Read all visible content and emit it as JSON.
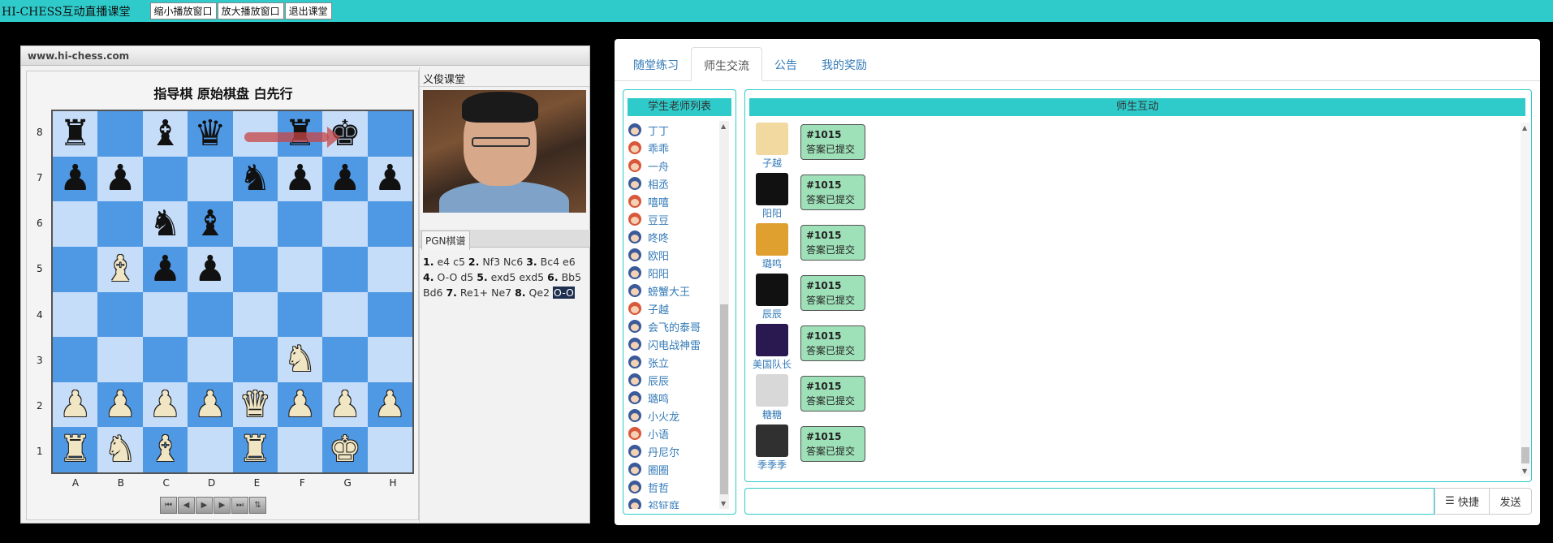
{
  "topbar": {
    "title": "HI-CHESS互动直播课堂",
    "buttons": [
      "缩小播放窗口",
      "放大播放窗口",
      "退出课堂"
    ]
  },
  "chess": {
    "site": "www.hi-chess.com",
    "title": "指导棋 原始棋盘 白先行",
    "ranks": [
      "8",
      "7",
      "6",
      "5",
      "4",
      "3",
      "2",
      "1"
    ],
    "files": [
      "A",
      "B",
      "C",
      "D",
      "E",
      "F",
      "G",
      "H"
    ],
    "board": [
      [
        "r",
        "",
        "b",
        "q",
        "",
        "r",
        "k",
        ""
      ],
      [
        "p",
        "p",
        "",
        "",
        "n",
        "p",
        "p",
        "p"
      ],
      [
        "",
        "",
        "n",
        "b",
        "",
        "",
        "",
        ""
      ],
      [
        "",
        "B",
        "p",
        "p",
        "",
        "",
        "",
        ""
      ],
      [
        "",
        "",
        "",
        "",
        "",
        "",
        "",
        ""
      ],
      [
        "",
        "",
        "",
        "",
        "",
        "N",
        "",
        ""
      ],
      [
        "P",
        "P",
        "P",
        "P",
        "Q",
        "P",
        "P",
        "P"
      ],
      [
        "R",
        "N",
        "B",
        "",
        "R",
        "",
        "K",
        ""
      ]
    ],
    "nav_icons": [
      "first-move-icon",
      "prev-move-icon",
      "play-icon",
      "next-move-icon",
      "last-move-icon",
      "flip-board-icon"
    ],
    "video_title": "义俊课堂",
    "pgn_tab": "PGN棋谱",
    "pgn": [
      {
        "n": "1.",
        "w": "e4",
        "b": "c5"
      },
      {
        "n": "2.",
        "w": "Nf3",
        "b": "Nc6"
      },
      {
        "n": "3.",
        "w": "Bc4",
        "b": "e6"
      },
      {
        "n": "4.",
        "w": "O-O",
        "b": "d5"
      },
      {
        "n": "5.",
        "w": "exd5",
        "b": "exd5"
      },
      {
        "n": "6.",
        "w": "Bb5",
        "b": "Bd6"
      },
      {
        "n": "7.",
        "w": "Re1+",
        "b": "Ne7"
      },
      {
        "n": "8.",
        "w": "Qe2",
        "b": "O-O"
      }
    ]
  },
  "tabs": [
    "随堂练习",
    "师生交流",
    "公告",
    "我的奖励"
  ],
  "active_tab": 1,
  "user_list": {
    "title": "学生老师列表",
    "items": [
      {
        "name": "丁丁",
        "color": "blue"
      },
      {
        "name": "乖乖",
        "color": "red"
      },
      {
        "name": "一舟",
        "color": "red"
      },
      {
        "name": "相丞",
        "color": "blue"
      },
      {
        "name": "嘻嘻",
        "color": "red"
      },
      {
        "name": "豆豆",
        "color": "red"
      },
      {
        "name": "咚咚",
        "color": "blue"
      },
      {
        "name": "欧阳",
        "color": "blue"
      },
      {
        "name": "阳阳",
        "color": "blue"
      },
      {
        "name": "螃蟹大王",
        "color": "blue"
      },
      {
        "name": "子越",
        "color": "red"
      },
      {
        "name": "会飞的泰哥",
        "color": "blue"
      },
      {
        "name": "闪电战神雷",
        "color": "blue"
      },
      {
        "name": "张立",
        "color": "blue"
      },
      {
        "name": "辰辰",
        "color": "blue"
      },
      {
        "name": "璐鸣",
        "color": "blue"
      },
      {
        "name": "小火龙",
        "color": "blue"
      },
      {
        "name": "小语",
        "color": "red"
      },
      {
        "name": "丹尼尔",
        "color": "blue"
      },
      {
        "name": "圈圈",
        "color": "blue"
      },
      {
        "name": "哲哲",
        "color": "blue"
      },
      {
        "name": "祁钲庭",
        "color": "blue"
      }
    ]
  },
  "chat": {
    "title": "师生互动",
    "messages": [
      {
        "user": "子越",
        "code": "#1015",
        "text": "答案已提交",
        "avatar": "#f1d9a0"
      },
      {
        "user": "阳阳",
        "code": "#1015",
        "text": "答案已提交",
        "avatar": "#111111"
      },
      {
        "user": "璐鸣",
        "code": "#1015",
        "text": "答案已提交",
        "avatar": "#e0a030"
      },
      {
        "user": "辰辰",
        "code": "#1015",
        "text": "答案已提交",
        "avatar": "#111111"
      },
      {
        "user": "美国队长",
        "code": "#1015",
        "text": "答案已提交",
        "avatar": "#2a1850"
      },
      {
        "user": "糖糖",
        "code": "#1015",
        "text": "答案已提交",
        "avatar": "#d8d8d8"
      },
      {
        "user": "季季季",
        "code": "#1015",
        "text": "答案已提交",
        "avatar": "#303030"
      }
    ],
    "quick_label": "快捷",
    "send_label": "发送",
    "input_value": ""
  }
}
